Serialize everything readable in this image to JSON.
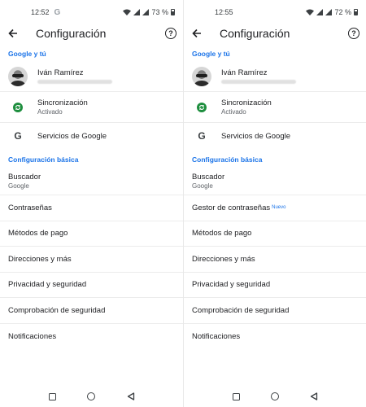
{
  "left": {
    "status": {
      "time": "12:52",
      "g_glyph": "G",
      "battery": "73 %"
    },
    "toolbar": {
      "title": "Configuración",
      "help_glyph": "?"
    },
    "section_google": "Google y tú",
    "profile": {
      "name": "Iván Ramírez"
    },
    "sync": {
      "title": "Sincronización",
      "status": "Activado"
    },
    "services": {
      "icon_letter": "G",
      "label": "Servicios de Google"
    },
    "section_basic": "Configuración básica",
    "search": {
      "title": "Buscador",
      "value": "Google"
    },
    "items": [
      "Contraseñas",
      "Métodos de pago",
      "Direcciones y más",
      "Privacidad y seguridad",
      "Comprobación de seguridad",
      "Notificaciones"
    ]
  },
  "right": {
    "status": {
      "time": "12:55",
      "battery": "72 %"
    },
    "toolbar": {
      "title": "Configuración",
      "help_glyph": "?"
    },
    "section_google": "Google y tú",
    "profile": {
      "name": "Iván Ramírez"
    },
    "sync": {
      "title": "Sincronización",
      "status": "Activado"
    },
    "services": {
      "icon_letter": "G",
      "label": "Servicios de Google"
    },
    "section_basic": "Configuración básica",
    "search": {
      "title": "Buscador",
      "value": "Google"
    },
    "passwords": {
      "label": "Gestor de contraseñas",
      "badge": "Nuevo"
    },
    "items": [
      "Métodos de pago",
      "Direcciones y más",
      "Privacidad y seguridad",
      "Comprobación de seguridad",
      "Notificaciones"
    ]
  },
  "colors": {
    "accent": "#1a73e8",
    "sync_green": "#1e8e3e",
    "text": "#202124",
    "subtext": "#5f6368"
  },
  "icons": [
    "back-arrow-icon",
    "help-icon",
    "avatar",
    "sync-icon",
    "google-g-icon",
    "nav-recents-icon",
    "nav-home-icon",
    "nav-back-icon"
  ]
}
